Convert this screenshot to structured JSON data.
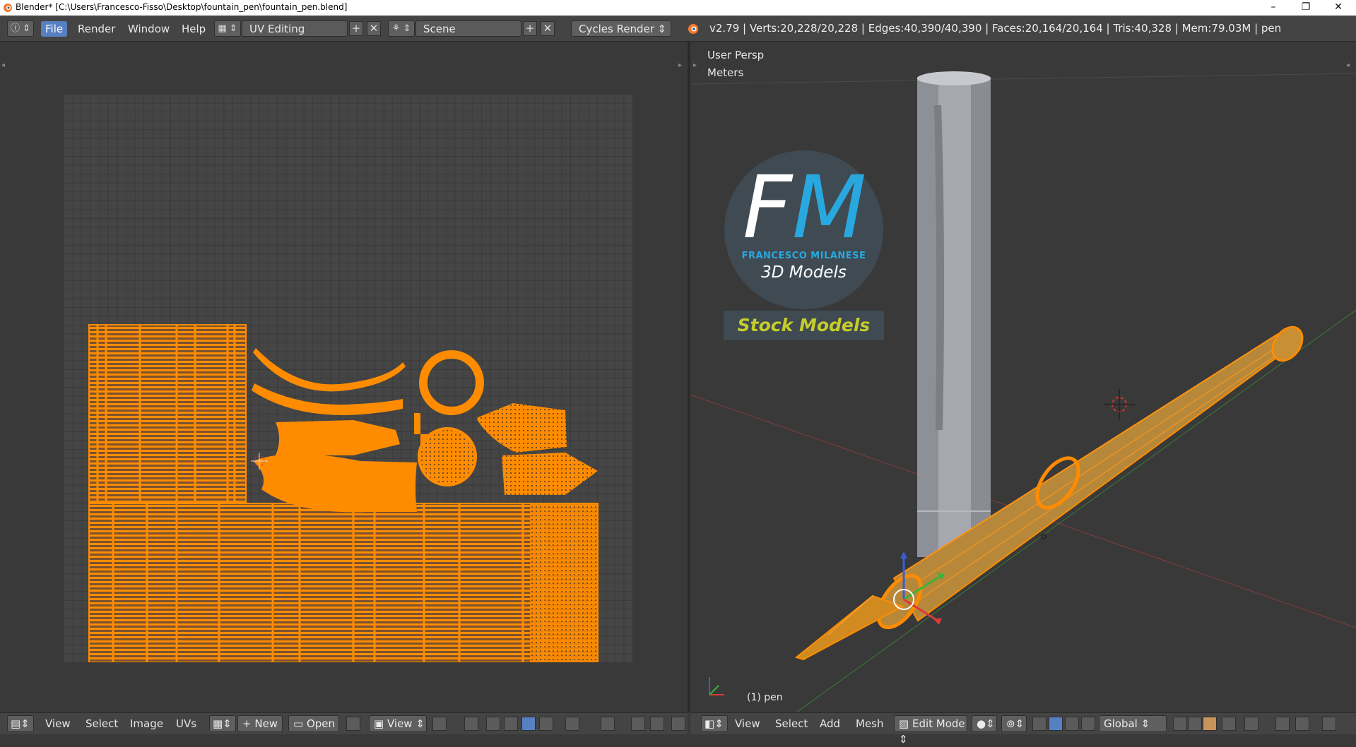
{
  "window": {
    "title": "Blender* [C:\\Users\\Francesco-Fisso\\Desktop\\fountain_pen\\fountain_pen.blend]",
    "minimize_glyph": "–",
    "maximize_glyph": "❐",
    "close_glyph": "✕"
  },
  "header": {
    "menus": [
      "File",
      "Render",
      "Window",
      "Help"
    ],
    "active_menu": "File",
    "screen_layout": "UV Editing",
    "scene": "Scene",
    "render_engine": "Cycles Render",
    "stats": "v2.79 | Verts:20,228/20,228 | Edges:40,390/40,390 | Faces:20,164/20,164 | Tris:40,328 | Mem:79.03M | pen",
    "add_glyph": "+",
    "remove_glyph": "✕",
    "updown_glyph": "⇕"
  },
  "uv_editor": {
    "menus": [
      "View",
      "Select",
      "Image",
      "UVs"
    ],
    "new_label": "New",
    "open_label": "Open",
    "view_label": "View"
  },
  "viewport": {
    "view_name": "User Persp",
    "units": "Meters",
    "object_label": "(1) pen",
    "menus": [
      "View",
      "Select",
      "Add",
      "Mesh"
    ],
    "mode": "Edit Mode",
    "orientation": "Global"
  },
  "logo": {
    "letter_f": "F",
    "letter_m": "M",
    "name": "FRANCESCO MILANESE",
    "subtitle": "3D Models",
    "banner": "Stock Models"
  },
  "colors": {
    "accent": "#5680c2",
    "uv_orange": "#ff8c00",
    "logo_blue": "#29a8df",
    "logo_yellow": "#c6cc2c"
  }
}
